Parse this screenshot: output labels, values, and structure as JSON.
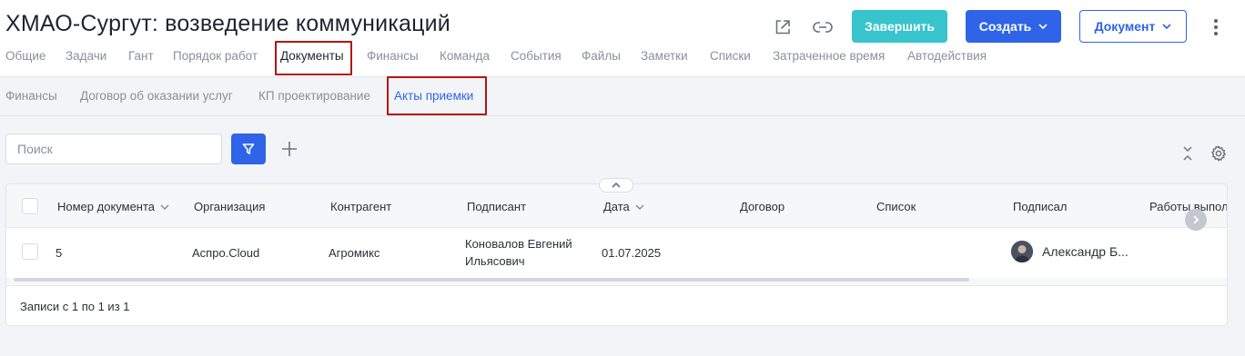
{
  "header": {
    "title": "ХМАО-Сургут: возведение коммуникаций",
    "finish_label": "Завершить",
    "create_label": "Создать",
    "document_label": "Документ"
  },
  "tabs": [
    {
      "label": "Общие"
    },
    {
      "label": "Задачи"
    },
    {
      "label": "Гант"
    },
    {
      "label": "Порядок работ"
    },
    {
      "label": "Документы",
      "active": true
    },
    {
      "label": "Финансы"
    },
    {
      "label": "Команда"
    },
    {
      "label": "События"
    },
    {
      "label": "Файлы"
    },
    {
      "label": "Заметки"
    },
    {
      "label": "Списки"
    },
    {
      "label": "Затраченное время"
    },
    {
      "label": "Автодействия"
    }
  ],
  "subtabs": [
    {
      "label": "Финансы"
    },
    {
      "label": "Договор об оказании услуг"
    },
    {
      "label": "КП проектирование"
    },
    {
      "label": "Акты приемки",
      "active": true
    }
  ],
  "toolbar": {
    "search_placeholder": "Поиск"
  },
  "table": {
    "columns": [
      "Номер документа",
      "Организация",
      "Контрагент",
      "Подписант",
      "Дата",
      "Договор",
      "Список",
      "Подписал",
      "Работы выпол"
    ],
    "rows": [
      {
        "number": "5",
        "organization": "Аспро.Cloud",
        "counterparty": "Агромикс",
        "signatory": "Коновалов Евгений Ильясович",
        "date": "01.07.2025",
        "contract": "",
        "list": "",
        "signed_by": "Александр Б...",
        "works": ""
      }
    ],
    "footer": "Записи с 1 по 1 из 1"
  },
  "colors": {
    "accent": "#2f64e8",
    "finish": "#38c4cc",
    "highlight": "#b31515"
  },
  "icons": [
    "open-external-icon",
    "link-icon",
    "chevron-down-icon",
    "more-vertical-icon",
    "filter-icon",
    "plus-icon",
    "collapse-icon",
    "settings-icon",
    "chevron-up-icon",
    "chevron-right-icon",
    "avatar"
  ]
}
